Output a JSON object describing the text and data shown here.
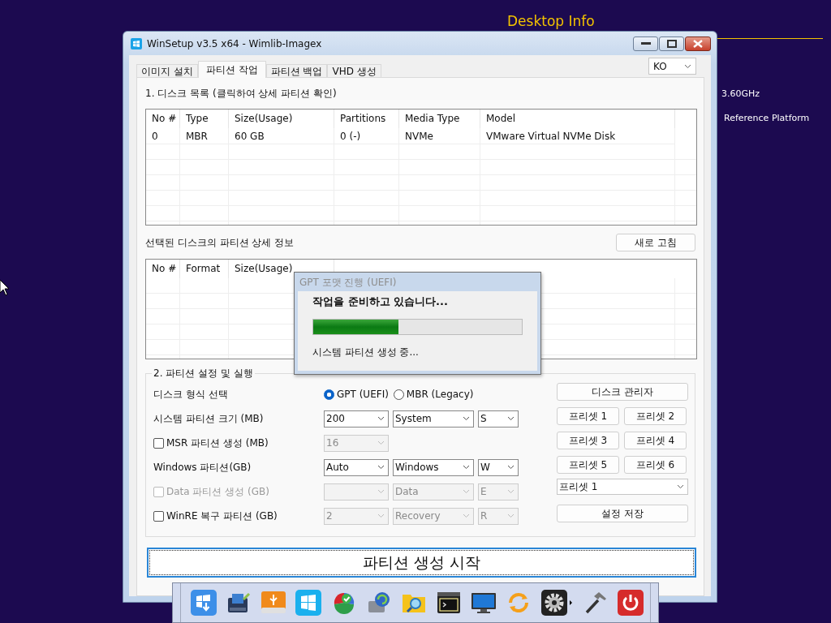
{
  "desktop": {
    "info_title": "Desktop Info",
    "info_lines": [
      "3.60GHz",
      "Reference Platform"
    ]
  },
  "window": {
    "title": "WinSetup v3.5 x64 - Wimlib-Imagex"
  },
  "tabs": [
    {
      "label": "이미지 설치",
      "selected": false
    },
    {
      "label": "파티션 작업",
      "selected": true
    },
    {
      "label": "파티션 백업",
      "selected": false
    },
    {
      "label": "VHD 생성",
      "selected": false
    }
  ],
  "language": {
    "value": "KO"
  },
  "disk_list": {
    "heading": "1. 디스크 목록 (클릭하여 상세 파티션 확인)",
    "columns": [
      "No #",
      "Type",
      "Size(Usage)",
      "Partitions",
      "Media Type",
      "Model"
    ],
    "rows": [
      [
        "0",
        "MBR",
        "60 GB",
        "0 (-)",
        "NVMe",
        "VMware Virtual NVMe Disk"
      ]
    ]
  },
  "partition_details": {
    "heading": "선택된 디스크의 파티션 상세 정보",
    "refresh_button": "새로 고침",
    "columns": [
      "No #",
      "Format",
      "Size(Usage)"
    ]
  },
  "settings": {
    "heading": "2. 파티션 설정 및 실행",
    "rows": [
      {
        "kind": "radio",
        "label": "디스크 형식 선택",
        "options": [
          {
            "label": "GPT (UEFI)",
            "selected": true
          },
          {
            "label": "MBR (Legacy)",
            "selected": false
          }
        ]
      },
      {
        "kind": "combos",
        "label": "시스템 파티션 크기 (MB)",
        "combos": [
          {
            "value": "200",
            "disabled": false
          },
          {
            "value": "System",
            "disabled": false
          },
          {
            "value": "S",
            "disabled": false
          }
        ]
      },
      {
        "kind": "check",
        "label": "MSR 파티션 생성 (MB)",
        "checked": false,
        "disabled": false,
        "combos": [
          {
            "value": "16",
            "disabled": true
          }
        ]
      },
      {
        "kind": "combos",
        "label": "Windows 파티션(GB)",
        "combos": [
          {
            "value": "Auto",
            "disabled": false
          },
          {
            "value": "Windows",
            "disabled": false
          },
          {
            "value": "W",
            "disabled": false
          }
        ]
      },
      {
        "kind": "check",
        "label": "Data 파티션 생성 (GB)",
        "checked": false,
        "disabled": true,
        "combos": [
          {
            "disabled": true
          },
          {
            "value": "Data",
            "disabled": true
          },
          {
            "value": "E",
            "disabled": true
          }
        ]
      },
      {
        "kind": "check",
        "label": "WinRE 복구 파티션 (GB)",
        "checked": false,
        "disabled": false,
        "combos": [
          {
            "value": "2",
            "disabled": true
          },
          {
            "value": "Recovery",
            "disabled": true
          },
          {
            "value": "R",
            "disabled": true
          }
        ]
      }
    ]
  },
  "disk_manager_button": "디스크 관리자",
  "preset_buttons": [
    "프리셋 1",
    "프리셋 2",
    "프리셋 3",
    "프리셋 4",
    "프리셋 5",
    "프리셋 6"
  ],
  "preset_select": {
    "value": "프리셋 1"
  },
  "save_button": "설정 저장",
  "start_button": "파티션 생성 시작",
  "progress_dialog": {
    "title": "GPT 포맷 진행 (UEFI)",
    "message": "작업을 준비하고 있습니다...",
    "level": 0.41,
    "status": "시스템 파티션 생성 중..."
  }
}
